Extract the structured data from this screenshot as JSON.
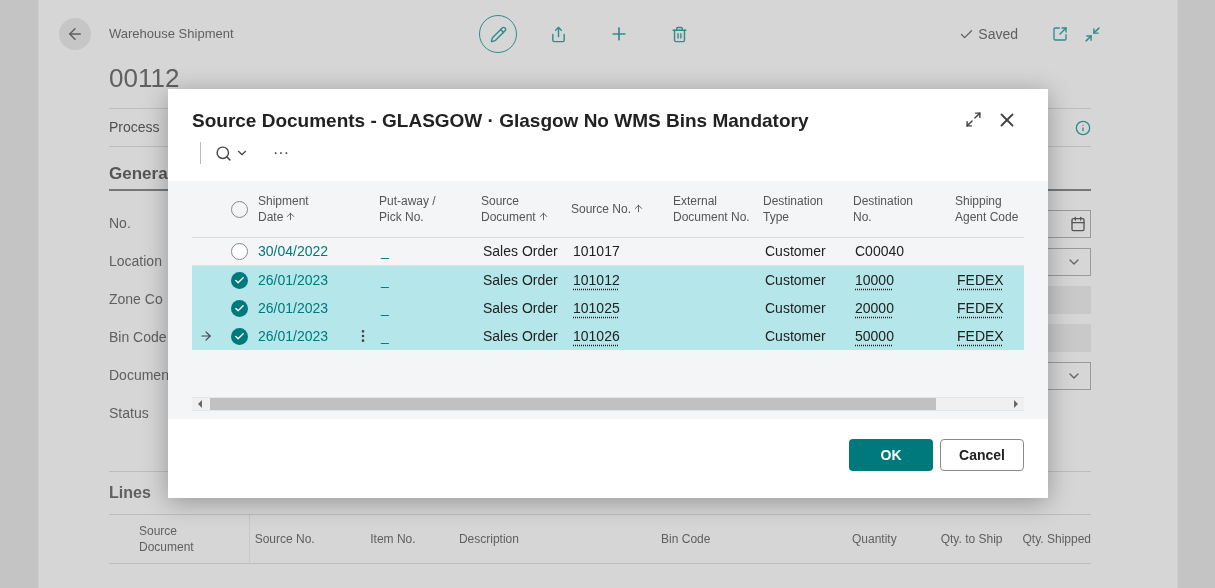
{
  "page": {
    "breadcrumb": "Warehouse Shipment",
    "number": "00112",
    "saved": "Saved",
    "action_tab": "Process",
    "section": "Genera",
    "fields": [
      {
        "label": "No.",
        "kind": "date"
      },
      {
        "label": "Location",
        "kind": "select"
      },
      {
        "label": "Zone Co",
        "kind": "disabled"
      },
      {
        "label": "Bin Code",
        "kind": "disabled"
      },
      {
        "label": "Documen",
        "kind": "select"
      },
      {
        "label": "Status",
        "kind": "none"
      }
    ],
    "lines": {
      "title": "Lines",
      "columns": [
        "Source Document",
        "Source No.",
        "Item No.",
        "Description",
        "Bin Code",
        "Quantity",
        "Qty. to Ship",
        "Qty. Shipped"
      ]
    }
  },
  "dialog": {
    "title": "Source Documents - GLASGOW · Glasgow No WMS Bins Mandatory",
    "more": "···",
    "all_selected": false,
    "columns": [
      {
        "label": "Shipment Date",
        "sorted": true
      },
      {
        "label": "Put-away / Pick No.",
        "sorted": false
      },
      {
        "label": "Source Document",
        "sorted": true
      },
      {
        "label": "Source No.",
        "sorted": true
      },
      {
        "label": "External Document No.",
        "sorted": false
      },
      {
        "label": "Destination Type",
        "sorted": false
      },
      {
        "label": "Destination No.",
        "sorted": false
      },
      {
        "label": "Shipping Agent Code",
        "sorted": false
      }
    ],
    "rows": [
      {
        "selected": false,
        "current": false,
        "cells": [
          "30/04/2022",
          "_",
          "Sales Order",
          "101017",
          "",
          "Customer",
          "C00040",
          ""
        ]
      },
      {
        "selected": true,
        "current": false,
        "cells": [
          "26/01/2023",
          "_",
          "Sales Order",
          "101012",
          "",
          "Customer",
          "10000",
          "FEDEX"
        ]
      },
      {
        "selected": true,
        "current": false,
        "cells": [
          "26/01/2023",
          "_",
          "Sales Order",
          "101025",
          "",
          "Customer",
          "20000",
          "FEDEX"
        ]
      },
      {
        "selected": true,
        "current": true,
        "cells": [
          "26/01/2023",
          "_",
          "Sales Order",
          "101026",
          "",
          "Customer",
          "50000",
          "FEDEX"
        ]
      }
    ],
    "buttons": [
      {
        "label": "OK",
        "kind": "primary"
      },
      {
        "label": "Cancel",
        "kind": "secondary"
      }
    ]
  }
}
